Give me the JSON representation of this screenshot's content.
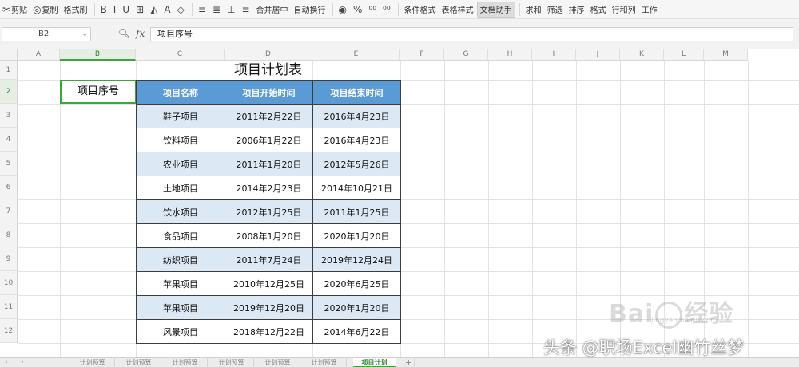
{
  "toolbar": {
    "items": [
      {
        "glyph": "✂",
        "label": "剪贴"
      },
      {
        "glyph": "◎",
        "label": "复制"
      },
      {
        "glyph": "",
        "label": "格式刷"
      },
      {
        "glyph": "B",
        "label": ""
      },
      {
        "glyph": "I",
        "label": ""
      },
      {
        "glyph": "U",
        "label": ""
      },
      {
        "glyph": "⊞",
        "label": ""
      },
      {
        "glyph": "◭",
        "label": ""
      },
      {
        "glyph": "A",
        "label": ""
      },
      {
        "glyph": "◇",
        "label": ""
      },
      {
        "glyph": "≡",
        "label": ""
      },
      {
        "glyph": "≣",
        "label": ""
      },
      {
        "glyph": "⊥",
        "label": ""
      },
      {
        "glyph": "≡",
        "label": ""
      },
      {
        "glyph": "",
        "label": "合并居中"
      },
      {
        "glyph": "",
        "label": "自动换行"
      },
      {
        "glyph": "◉",
        "label": ""
      },
      {
        "glyph": "%",
        "label": ""
      },
      {
        "glyph": "⁰⁰",
        "label": ""
      },
      {
        "glyph": "⁰⁰",
        "label": ""
      },
      {
        "glyph": "",
        "label": "条件格式"
      },
      {
        "glyph": "",
        "label": "表格样式"
      },
      {
        "glyph": "",
        "label": "文档助手"
      },
      {
        "glyph": "",
        "label": "求和"
      },
      {
        "glyph": "",
        "label": "筛选"
      },
      {
        "glyph": "",
        "label": "排序"
      },
      {
        "glyph": "",
        "label": "格式"
      },
      {
        "glyph": "",
        "label": "行和列"
      },
      {
        "glyph": "",
        "label": "工作"
      }
    ]
  },
  "formula_bar": {
    "cell_ref": "B2",
    "fx_label": "fx",
    "content": "项目序号"
  },
  "columns": [
    "A",
    "B",
    "C",
    "D",
    "E",
    "F",
    "G",
    "H",
    "I",
    "J",
    "K",
    "L",
    "M"
  ],
  "rows": [
    "1",
    "2",
    "3",
    "4",
    "5",
    "6",
    "7",
    "8",
    "9",
    "10",
    "11",
    "12"
  ],
  "sheet": {
    "title": "项目计划表",
    "b2_value": "项目序号",
    "headers": [
      "项目名称",
      "项目开始时间",
      "项目结束时间"
    ],
    "rows": [
      [
        "鞋子项目",
        "2011年2月22日",
        "2016年4月23日"
      ],
      [
        "饮料项目",
        "2006年1月22日",
        "2016年4月23日"
      ],
      [
        "农业项目",
        "2011年1月20日",
        "2012年5月26日"
      ],
      [
        "土地项目",
        "2014年2月23日",
        "2014年10月21日"
      ],
      [
        "饮水项目",
        "2012年1月25日",
        "2011年1月25日"
      ],
      [
        "食品项目",
        "2008年1月20日",
        "2020年1月20日"
      ],
      [
        "纺织项目",
        "2011年7月24日",
        "2019年12月24日"
      ],
      [
        "苹果项目",
        "2010年12月25日",
        "2020年6月25日"
      ],
      [
        "苹果项目",
        "2019年12月20日",
        "2020年1月20日"
      ],
      [
        "风景项目",
        "2018年12月22日",
        "2014年6月22日"
      ]
    ]
  },
  "tabs": {
    "items": [
      "计划预算",
      "计划预算",
      "计划预算",
      "计划预算",
      "计划预算",
      "计划预算"
    ],
    "active": "项目计划"
  },
  "watermarks": {
    "baidu": "Bai",
    "baidu_tail": "经验",
    "baidu_sub": "jingyan.baidu.com",
    "toutiao": "头条 @职场Excel幽竹丝梦"
  }
}
